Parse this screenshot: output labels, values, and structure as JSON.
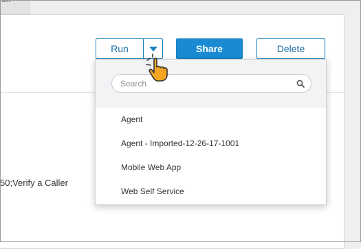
{
  "top_tab": {
    "label": "on"
  },
  "background_text": "50;Verify a Caller",
  "toolbar": {
    "run_label": "Run",
    "share_label": "Share",
    "delete_label": "Delete"
  },
  "dropdown": {
    "search_placeholder": "Search",
    "search_value": "",
    "items": [
      {
        "label": "Agent"
      },
      {
        "label": "Agent - Imported-12-26-17-1001"
      },
      {
        "label": "Mobile Web App"
      },
      {
        "label": "Web Self Service"
      }
    ]
  },
  "colors": {
    "accent": "#1a8bd3",
    "accent_border": "#1a7fc1",
    "cursor_fill": "#f5a623",
    "cursor_outline": "#333333"
  },
  "icons": {
    "search": "search-icon",
    "caret": "caret-down-icon",
    "cursor": "hand-pointer-icon"
  }
}
